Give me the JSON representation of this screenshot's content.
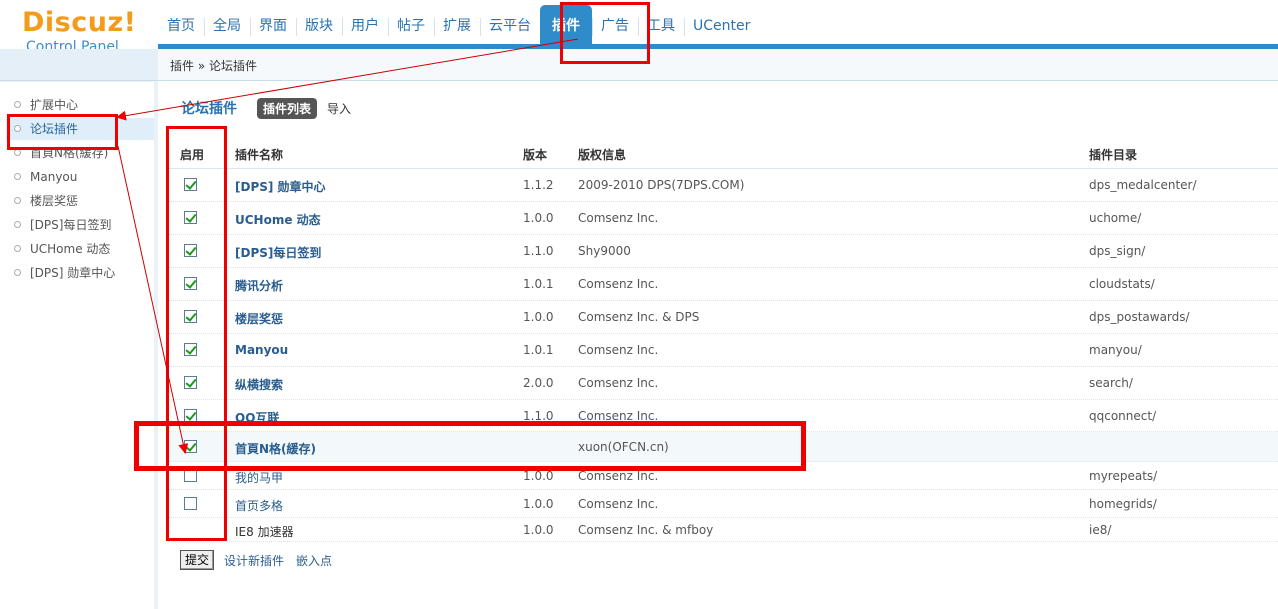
{
  "logo": {
    "main": "Discuz!",
    "sub": "Control Panel"
  },
  "nav": [
    "首页",
    "全局",
    "界面",
    "版块",
    "用户",
    "帖子",
    "扩展",
    "云平台",
    "插件",
    "广告",
    "工具",
    "UCenter"
  ],
  "nav_active": "插件",
  "breadcrumb": "插件 » 论坛插件",
  "sidebar": {
    "items": [
      "扩展中心",
      "论坛插件",
      "首頁N格(緩存)",
      "Manyou",
      "楼层奖惩",
      "[DPS]每日签到",
      "UCHome 动态",
      "[DPS] 勋章中心"
    ],
    "active": "论坛插件"
  },
  "main": {
    "title": "论坛插件",
    "tab_active": "插件列表",
    "tab_import": "导入"
  },
  "table": {
    "headers": {
      "enabled": "启用",
      "name": "插件名称",
      "version": "版本",
      "copyright": "版权信息",
      "directory": "插件目录"
    },
    "rows": [
      {
        "enabled": true,
        "name": "[DPS] 勋章中心",
        "version": "1.1.2",
        "copyright": "2009-2010 DPS(7DPS.COM)",
        "directory": "dps_medalcenter/"
      },
      {
        "enabled": true,
        "name": "UCHome 动态",
        "version": "1.0.0",
        "copyright": "Comsenz Inc.",
        "directory": "uchome/"
      },
      {
        "enabled": true,
        "name": "[DPS]每日签到",
        "version": "1.1.0",
        "copyright": "Shy9000",
        "directory": "dps_sign/"
      },
      {
        "enabled": true,
        "name": "腾讯分析",
        "version": "1.0.1",
        "copyright": "Comsenz Inc.",
        "directory": "cloudstats/"
      },
      {
        "enabled": true,
        "name": "楼层奖惩",
        "version": "1.0.0",
        "copyright": "Comsenz Inc. & DPS",
        "directory": "dps_postawards/"
      },
      {
        "enabled": true,
        "name": "Manyou",
        "version": "1.0.1",
        "copyright": "Comsenz Inc.",
        "directory": "manyou/"
      },
      {
        "enabled": true,
        "name": "纵横搜索",
        "version": "2.0.0",
        "copyright": "Comsenz Inc.",
        "directory": "search/"
      },
      {
        "enabled": true,
        "name": "QQ互联",
        "version": "1.1.0",
        "copyright": "Comsenz Inc.",
        "directory": "qqconnect/"
      },
      {
        "enabled": true,
        "name": "首頁N格(緩存)",
        "version": "",
        "copyright": "xuon(OFCN.cn)",
        "directory": ""
      },
      {
        "enabled": false,
        "name": "我的马甲",
        "version": "1.0.0",
        "copyright": "Comsenz Inc.",
        "directory": "myrepeats/"
      },
      {
        "enabled": false,
        "name": "首页多格",
        "version": "1.0.0",
        "copyright": "Comsenz Inc.",
        "directory": "homegrids/"
      },
      {
        "enabled": false,
        "name": "IE8 加速器",
        "version": "1.0.0",
        "copyright": "Comsenz Inc. & mfboy",
        "directory": "ie8/"
      }
    ]
  },
  "footer": {
    "submit": "提交",
    "design_link": "设计新插件",
    "embed_link": "嵌入点"
  },
  "colors": {
    "accent": "#2f8bc9",
    "logo": "#f39b1b",
    "annotation": "#ee0000"
  }
}
